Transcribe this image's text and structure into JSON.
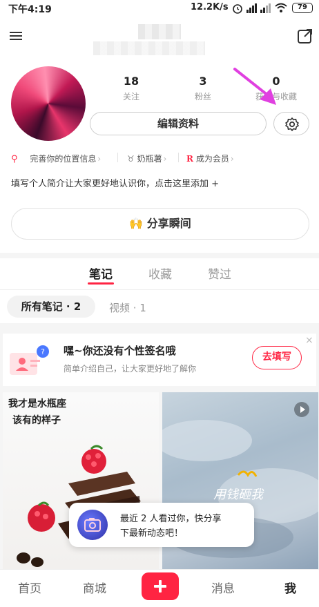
{
  "status_bar": {
    "time": "下午4:19",
    "network_speed": "12.2K/s",
    "battery": "79"
  },
  "profile": {
    "stats": [
      {
        "value": "18",
        "label": "关注"
      },
      {
        "value": "3",
        "label": "粉丝"
      },
      {
        "value": "0",
        "label": "获赞与收藏"
      }
    ],
    "edit_label": "编辑资料",
    "chips": [
      {
        "label": "完善你的位置信息"
      },
      {
        "label": "奶瓶薯"
      },
      {
        "icon_text": "R",
        "label": "成为会员"
      }
    ],
    "bio_prompt": "填写个人简介让大家更好地认识你，点击这里添加 +",
    "share_label": "分享瞬间"
  },
  "tabs": [
    {
      "label": "笔记"
    },
    {
      "label": "收藏"
    },
    {
      "label": "赞过"
    }
  ],
  "filters": {
    "all_notes": "所有笔记 · 2",
    "videos": "视频 · 1"
  },
  "bio_card": {
    "title": "嘿~你还没有个性签名哦",
    "subtitle": "简单介绍自己，让大家更好地了解你",
    "button": "去填写",
    "close": "×"
  },
  "notes": {
    "left_caption_line1": "我才是水瓶座",
    "left_caption_line2": "该有的样子",
    "right_caption": "用钱砸我"
  },
  "popup": {
    "line1": "最近 2 人看过你，快分享",
    "line2": "下最新动态吧！"
  },
  "nav": [
    {
      "label": "首页"
    },
    {
      "label": "商城"
    },
    {
      "label": "消息"
    },
    {
      "label": "我"
    }
  ],
  "colors": {
    "accent": "#ff2442",
    "annotation_arrow": "#e040e0"
  }
}
